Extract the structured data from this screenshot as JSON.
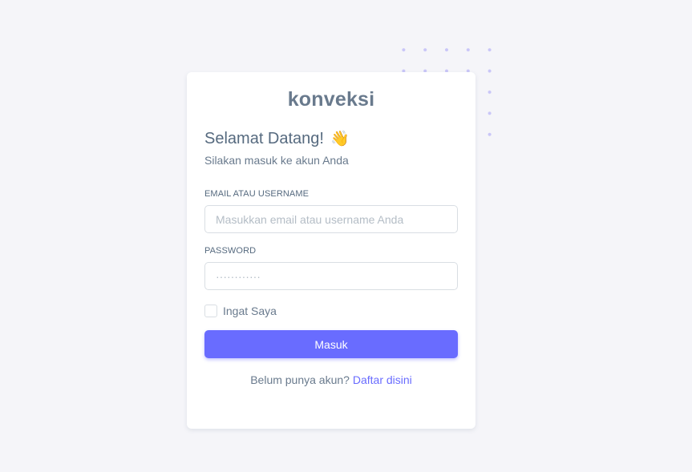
{
  "brand": {
    "name": "konveksi"
  },
  "heading": {
    "title": "Selamat Datang!",
    "emoji": "👋",
    "subtitle": "Silakan masuk ke akun Anda"
  },
  "form": {
    "email_label": "EMAIL ATAU USERNAME",
    "email_placeholder": "Masukkan email atau username Anda",
    "email_value": "",
    "password_label": "PASSWORD",
    "password_placeholder": "············",
    "password_value": "",
    "remember_label": "Ingat Saya",
    "remember_checked": false,
    "submit_label": "Masuk"
  },
  "footer": {
    "prompt": "Belum punya akun?",
    "link_label": "Daftar disini"
  },
  "colors": {
    "primary": "#696cff",
    "background": "#f5f5f9",
    "text": "#697a8d",
    "heading": "#566a7f"
  }
}
